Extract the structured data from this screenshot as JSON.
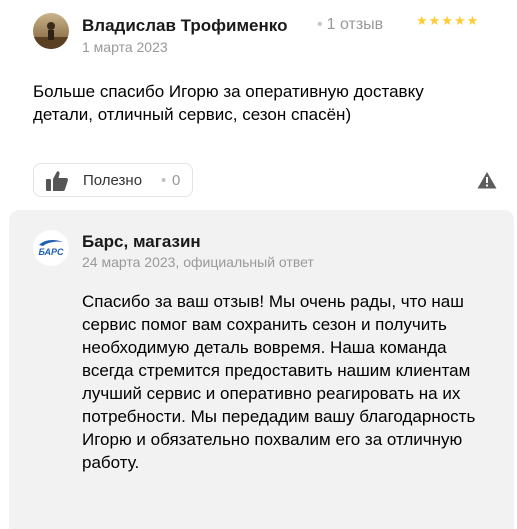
{
  "review": {
    "author": "Владислав Трофименко",
    "review_count": "1 отзыв",
    "rating": 5,
    "stars": "★★★★★",
    "date": "1 марта 2023",
    "text": "Больше спасибо Игорю за оперативную доставку детали, отличный сервис, сезон спасён)",
    "like_label": "Полезно",
    "like_separator": "•",
    "like_count": "0",
    "avatar_icon": "user-photo",
    "report_icon": "warning-triangle-icon"
  },
  "answer": {
    "author": "Барс, магазин",
    "logo_text": "БАРС",
    "meta": "24 марта 2023, официальный ответ",
    "text": "Спасибо за ваш отзыв! Мы очень рады, что наш сервис помог вам сохранить сезон и получить необходимую деталь вовремя. Наша команда всегда стремится предоставить нашим клиентам лучший сервис и оперативно реагировать на их потребности. Мы передадим вашу благодарность Игорю и обязательно похвалим его за отличную работу."
  },
  "colors": {
    "star": "#ffcc33",
    "muted": "#999999",
    "answer_bg": "#f2f2f2",
    "logo_blue": "#1f5fb0"
  }
}
